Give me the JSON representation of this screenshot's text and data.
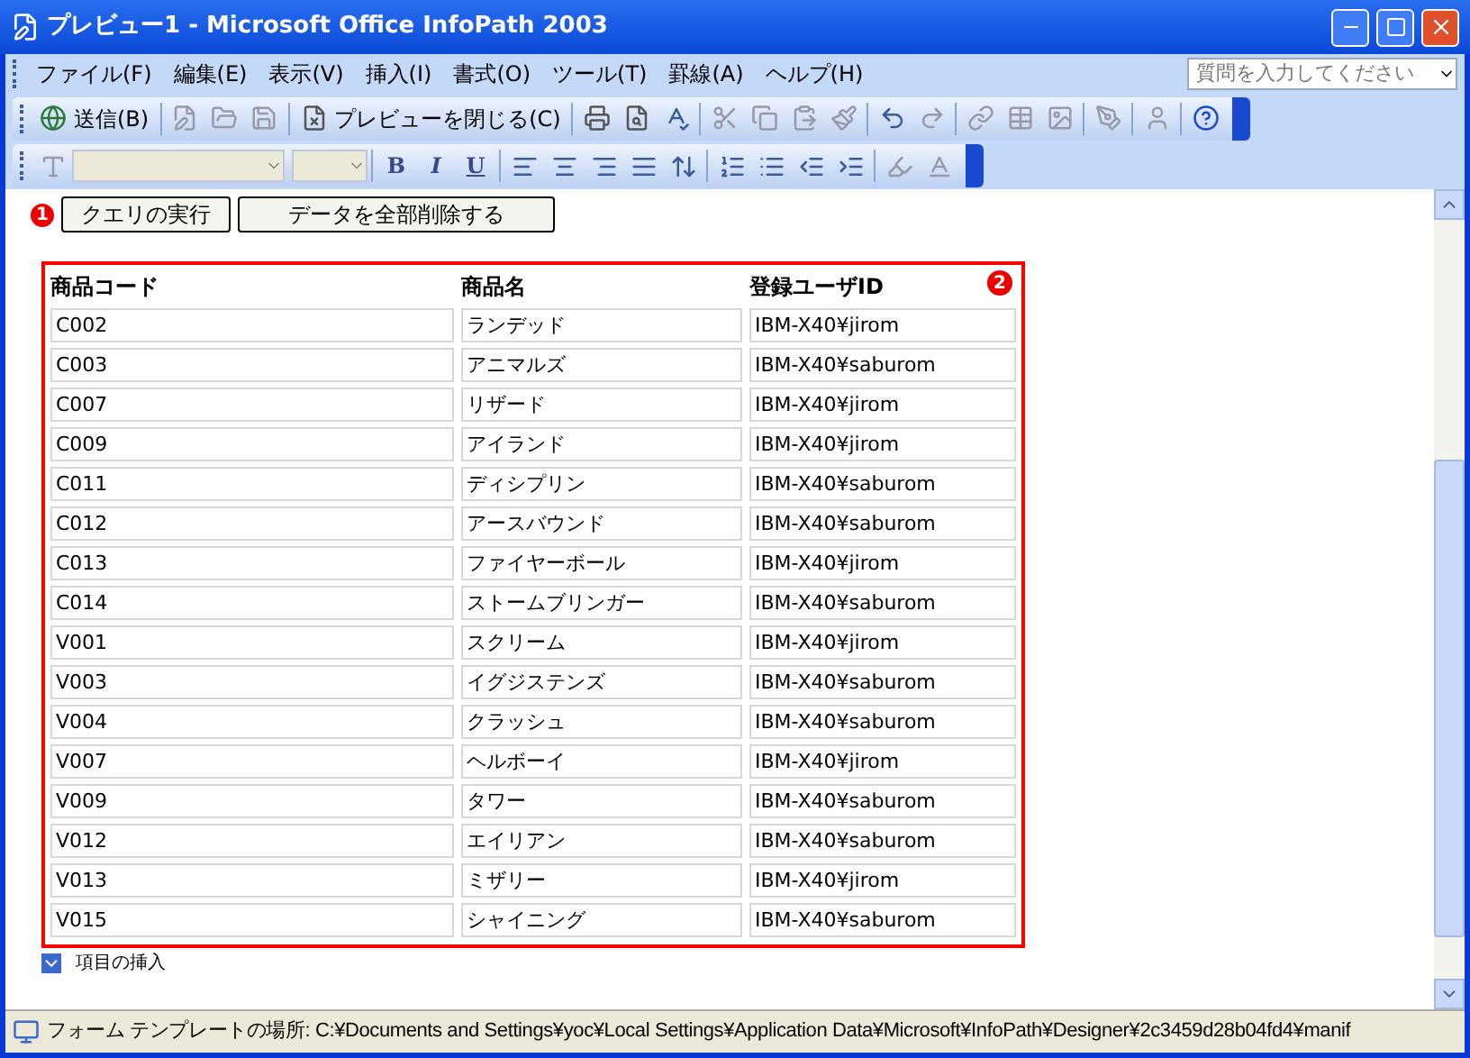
{
  "window": {
    "title": "プレビュー1 - Microsoft Office InfoPath 2003"
  },
  "menu": [
    "ファイル(F)",
    "編集(E)",
    "表示(V)",
    "挿入(I)",
    "書式(O)",
    "ツール(T)",
    "罫線(A)",
    "ヘルプ(H)"
  ],
  "help_search": {
    "placeholder": "質問を入力してください"
  },
  "standard_toolbar": {
    "send": "送信(B)",
    "close_preview": "プレビューを閉じる(C)"
  },
  "format_toolbar": {
    "bold": "B",
    "italic": "I",
    "underline": "U"
  },
  "form": {
    "callout_1": "1",
    "query_button": "クエリの実行",
    "delete_button": "データを全部削除する",
    "callout_2": "2",
    "columns": [
      "商品コード",
      "商品名",
      "登録ユーザID"
    ],
    "rows": [
      [
        "C002",
        "ランデッド",
        "IBM-X40¥jirom"
      ],
      [
        "C003",
        "アニマルズ",
        "IBM-X40¥saburom"
      ],
      [
        "C007",
        "リザード",
        "IBM-X40¥jirom"
      ],
      [
        "C009",
        "アイランド",
        "IBM-X40¥jirom"
      ],
      [
        "C011",
        "ディシプリン",
        "IBM-X40¥saburom"
      ],
      [
        "C012",
        "アースバウンド",
        "IBM-X40¥saburom"
      ],
      [
        "C013",
        "ファイヤーボール",
        "IBM-X40¥jirom"
      ],
      [
        "C014",
        "ストームブリンガー",
        "IBM-X40¥saburom"
      ],
      [
        "V001",
        "スクリーム",
        "IBM-X40¥jirom"
      ],
      [
        "V003",
        "イグジステンズ",
        "IBM-X40¥saburom"
      ],
      [
        "V004",
        "クラッシュ",
        "IBM-X40¥saburom"
      ],
      [
        "V007",
        "ヘルボーイ",
        "IBM-X40¥jirom"
      ],
      [
        "V009",
        "タワー",
        "IBM-X40¥saburom"
      ],
      [
        "V012",
        "エイリアン",
        "IBM-X40¥saburom"
      ],
      [
        "V013",
        "ミザリー",
        "IBM-X40¥jirom"
      ],
      [
        "V015",
        "シャイニング",
        "IBM-X40¥saburom"
      ]
    ],
    "insert_item": "項目の挿入"
  },
  "status_bar": "フォーム テンプレートの場所: C:¥Documents and Settings¥yoc¥Local Settings¥Application Data¥Microsoft¥InfoPath¥Designer¥2c3459d28b04fd4¥manif"
}
